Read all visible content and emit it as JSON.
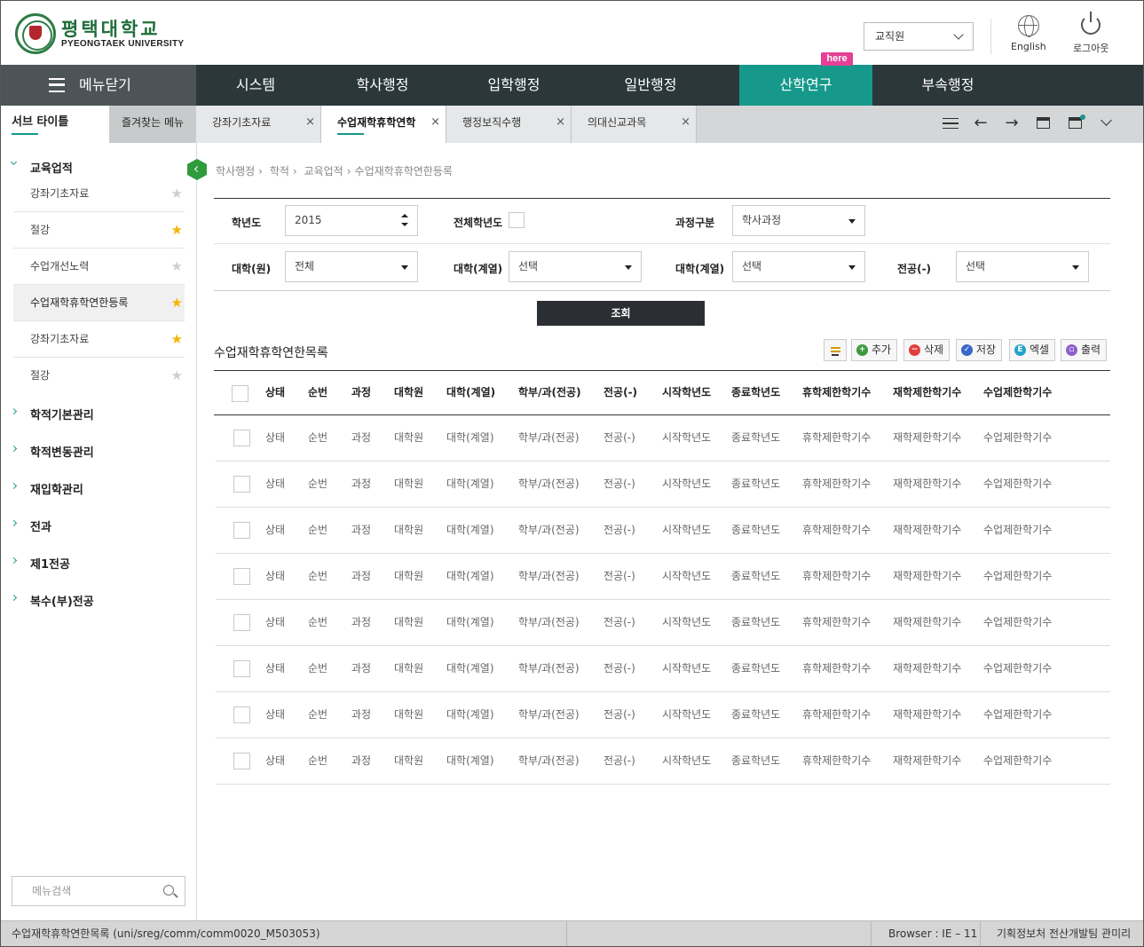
{
  "header": {
    "logo_ko": "평택대학교",
    "logo_en": "PYEONGTAEK UNIVERSITY",
    "role_select": "교직원",
    "english_label": "English",
    "logout_label": "로그아웃"
  },
  "nav": {
    "menu_close": "메뉴닫기",
    "here_badge": "here",
    "items": [
      {
        "label": "시스템"
      },
      {
        "label": "학사행정"
      },
      {
        "label": "입학행정"
      },
      {
        "label": "일반행정"
      },
      {
        "label": "산학연구",
        "active": true
      },
      {
        "label": "부속행정"
      }
    ]
  },
  "tabs": {
    "subtitle": "서브 타이틀",
    "favorites": "즐겨찾는 메뉴",
    "open": [
      {
        "label": "강좌기초자료"
      },
      {
        "label": "수업재학휴학연학",
        "active": true
      },
      {
        "label": "행정보직수행"
      },
      {
        "label": "의대신교과목"
      }
    ],
    "close_glyph": "×"
  },
  "sidebar": {
    "group_open": "교육업적",
    "items": [
      {
        "label": "강좌기초자료",
        "starred": false
      },
      {
        "label": "절강",
        "starred": true
      },
      {
        "label": "수업개선노력",
        "starred": false
      },
      {
        "label": "수업재학휴학연한등록",
        "starred": true,
        "selected": true
      },
      {
        "label": "강좌기초자료",
        "starred": true
      },
      {
        "label": "절강",
        "starred": false
      }
    ],
    "groups": [
      "학적기본관리",
      "학적변동관리",
      "재입학관리",
      "전과",
      "제1전공",
      "복수(부)전공"
    ],
    "search_placeholder": "메뉴검색"
  },
  "breadcrumb": [
    "학사행정",
    "학적",
    "교육업적",
    "수업재학휴학연한등록"
  ],
  "filters": {
    "year_label": "학년도",
    "year_value": "2015",
    "all_years_label": "전체학년도",
    "course_label": "과정구분",
    "course_value": "학사과정",
    "grad_label": "대학(원)",
    "grad_value": "전체",
    "college_label": "대학(계열)",
    "college_value": "선택",
    "college2_label": "대학(계열)",
    "college2_value": "선택",
    "major_label": "전공(-)",
    "major_value": "선택",
    "search_button": "조회"
  },
  "list": {
    "title": "수업재학휴학연한목록",
    "buttons": {
      "add": "추가",
      "delete": "삭제",
      "save": "저장",
      "excel": "엑셀",
      "print": "출력"
    },
    "columns": [
      "상태",
      "순번",
      "과정",
      "대학원",
      "대학(계열)",
      "학부/과(전공)",
      "전공(-)",
      "시작학년도",
      "종료학년도",
      "휴학제한학기수",
      "재학제한학기수",
      "수업제한학기수"
    ],
    "rows": [
      [
        "상태",
        "순번",
        "과정",
        "대학원",
        "대학(계열)",
        "학부/과(전공)",
        "전공(-)",
        "시작학년도",
        "종료학년도",
        "휴학제한학기수",
        "재학제한학기수",
        "수업제한학기수"
      ],
      [
        "상태",
        "순번",
        "과정",
        "대학원",
        "대학(계열)",
        "학부/과(전공)",
        "전공(-)",
        "시작학년도",
        "종료학년도",
        "휴학제한학기수",
        "재학제한학기수",
        "수업제한학기수"
      ],
      [
        "상태",
        "순번",
        "과정",
        "대학원",
        "대학(계열)",
        "학부/과(전공)",
        "전공(-)",
        "시작학년도",
        "종료학년도",
        "휴학제한학기수",
        "재학제한학기수",
        "수업제한학기수"
      ],
      [
        "상태",
        "순번",
        "과정",
        "대학원",
        "대학(계열)",
        "학부/과(전공)",
        "전공(-)",
        "시작학년도",
        "종료학년도",
        "휴학제한학기수",
        "재학제한학기수",
        "수업제한학기수"
      ],
      [
        "상태",
        "순번",
        "과정",
        "대학원",
        "대학(계열)",
        "학부/과(전공)",
        "전공(-)",
        "시작학년도",
        "종료학년도",
        "휴학제한학기수",
        "재학제한학기수",
        "수업제한학기수"
      ],
      [
        "상태",
        "순번",
        "과정",
        "대학원",
        "대학(계열)",
        "학부/과(전공)",
        "전공(-)",
        "시작학년도",
        "종료학년도",
        "휴학제한학기수",
        "재학제한학기수",
        "수업제한학기수"
      ],
      [
        "상태",
        "순번",
        "과정",
        "대학원",
        "대학(계열)",
        "학부/과(전공)",
        "전공(-)",
        "시작학년도",
        "종료학년도",
        "휴학제한학기수",
        "재학제한학기수",
        "수업제한학기수"
      ],
      [
        "상태",
        "순번",
        "과정",
        "대학원",
        "대학(계열)",
        "학부/과(전공)",
        "전공(-)",
        "시작학년도",
        "종료학년도",
        "휴학제한학기수",
        "재학제한학기수",
        "수업제한학기수"
      ]
    ]
  },
  "statusbar": {
    "path": "수업재학휴학연한목록 (uni/sreg/comm/comm0020_M503053)",
    "browser": "Browser : IE – 11",
    "owner": "기획정보처 전산개발팀 관미리"
  },
  "colors": {
    "accent": "#16998b",
    "nav": "#2b373b",
    "here": "#e53f96",
    "star": "#f5b400"
  }
}
